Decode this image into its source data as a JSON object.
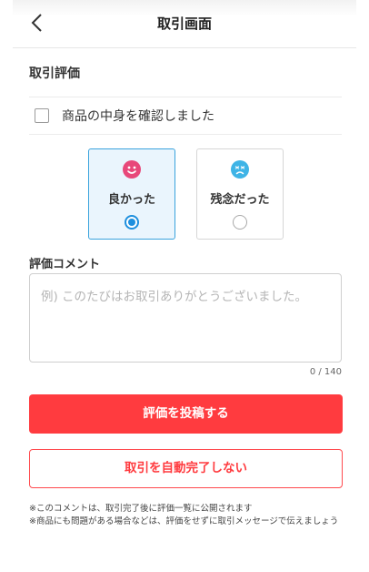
{
  "header": {
    "title": "取引画面"
  },
  "evaluation": {
    "section_title": "取引評価",
    "checkbox_label": "商品の中身を確認しました",
    "good_label": "良かった",
    "bad_label": "残念だった",
    "selected": "good"
  },
  "comment": {
    "title": "評価コメント",
    "placeholder": "例) このたびはお取引ありがとうございました。",
    "counter": "0 / 140"
  },
  "buttons": {
    "post": "評価を投稿する",
    "no_auto_complete": "取引を自動完了しない"
  },
  "notes": [
    "※このコメントは、取引完了後に評価一覧に公開されます",
    "※商品にも問題がある場合などは、評価をせずに取引メッセージで伝えましょう"
  ],
  "colors": {
    "accent_red": "#ff3b3f",
    "accent_blue": "#1e8fde",
    "good_face": "#e8487a",
    "bad_face": "#3fb4e6"
  }
}
